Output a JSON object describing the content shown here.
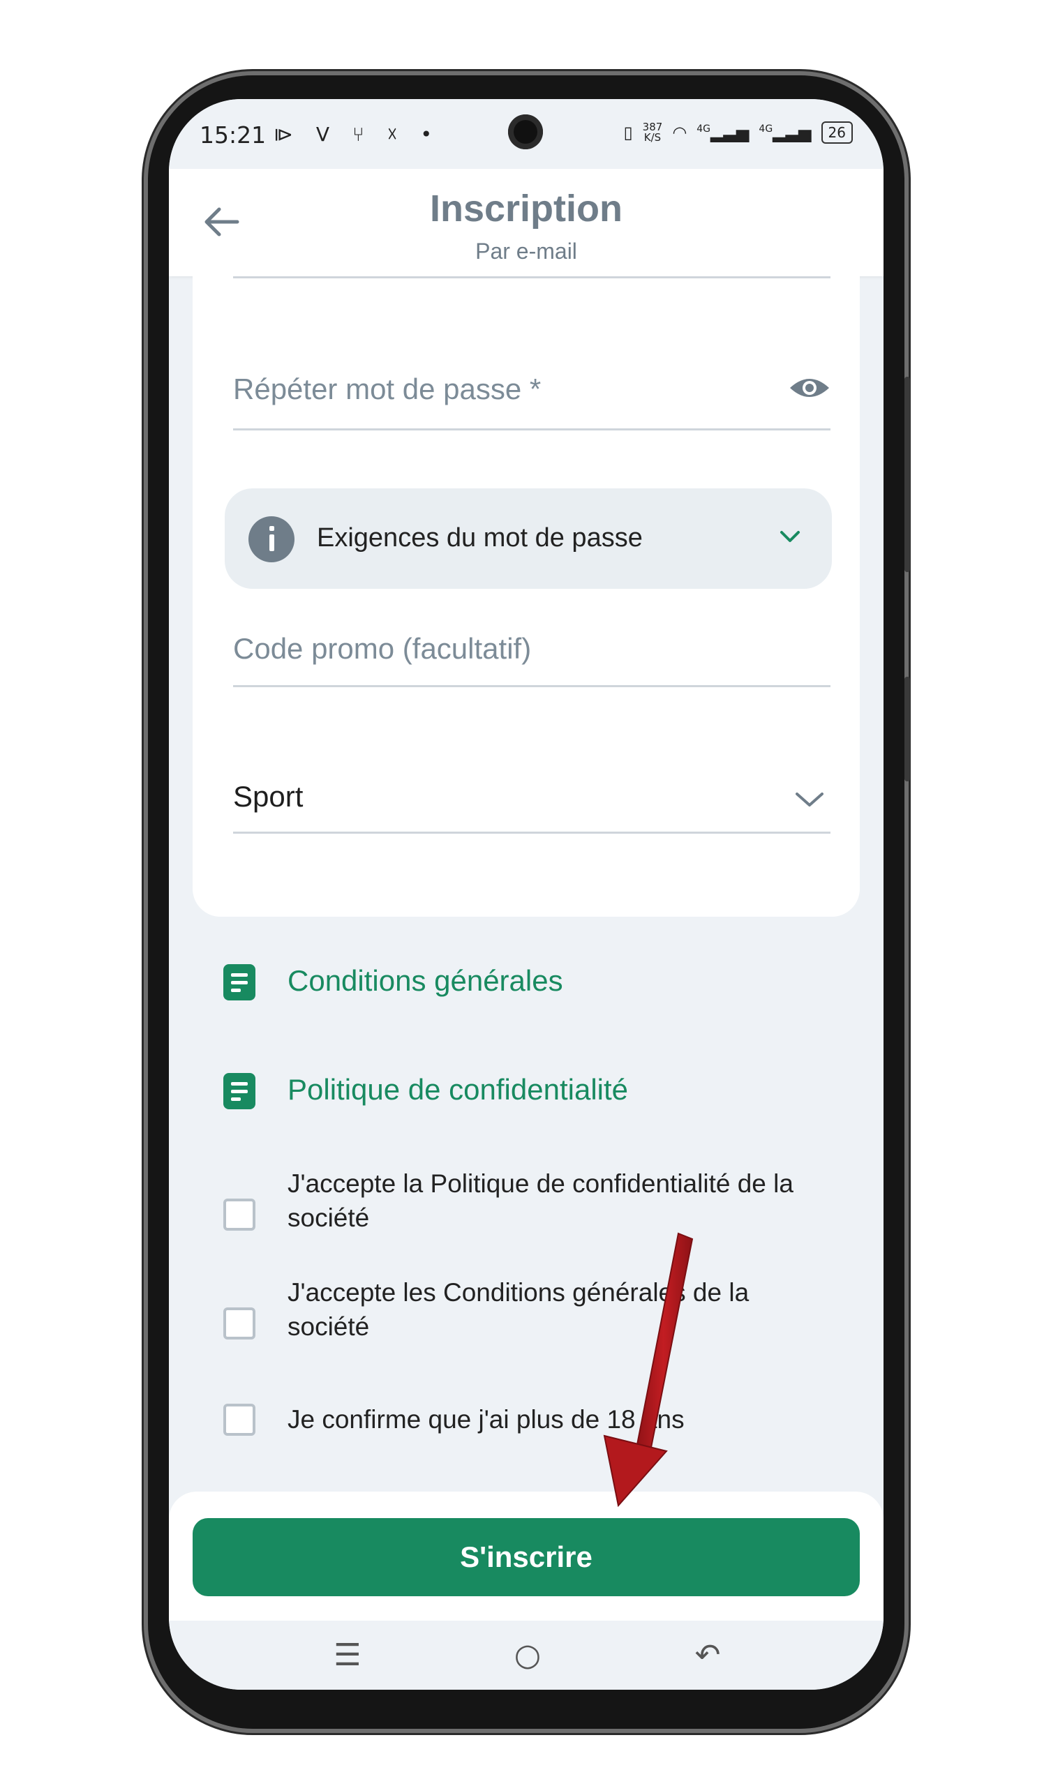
{
  "status_bar": {
    "time": "15:21",
    "left_icons": "⧐ V ⑂ ☓ •",
    "net_speed_value": "387",
    "net_speed_unit": "K/S",
    "signal_1": "4G",
    "signal_2": "4G",
    "battery": "26"
  },
  "header": {
    "title": "Inscription",
    "subtitle": "Par e-mail"
  },
  "form": {
    "repeat_password_placeholder": "Répéter mot de passe *",
    "password_requirements_label": "Exigences du mot de passe",
    "promo_code_placeholder": "Code promo (facultatif)",
    "category_value": "Sport"
  },
  "links": {
    "terms": "Conditions générales",
    "privacy": "Politique de confidentialité"
  },
  "checkboxes": [
    {
      "label": "J'accepte la Politique de confidentialité de la société",
      "checked": false
    },
    {
      "label": "J'accepte les Conditions générales de la société",
      "checked": false
    },
    {
      "label": "Je confirme que j'ai plus de 18 ans",
      "checked": false
    }
  ],
  "submit_label": "S'inscrire",
  "nav": {
    "recent": "☰",
    "home": "○",
    "back": "↶"
  },
  "colors": {
    "accent": "#188a60",
    "annotation_arrow": "#b3191d",
    "muted_text": "#6f7d89"
  }
}
